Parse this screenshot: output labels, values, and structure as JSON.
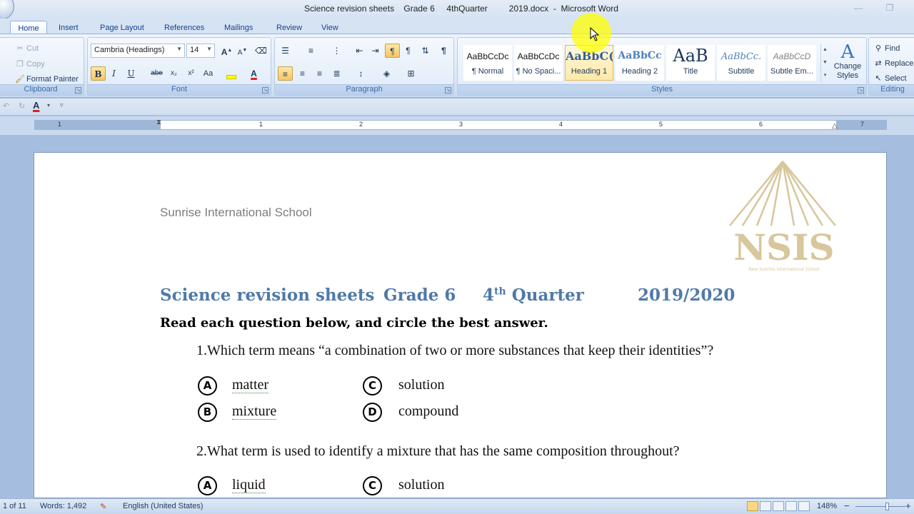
{
  "window": {
    "title": "Science revision sheets    Grade 6     4thQuarter         2019.docx  -  Microsoft Word",
    "minimize": "—",
    "restore": "❐"
  },
  "tabs": [
    {
      "label": "Home",
      "active": true
    },
    {
      "label": "Insert"
    },
    {
      "label": "Page Layout"
    },
    {
      "label": "References"
    },
    {
      "label": "Mailings"
    },
    {
      "label": "Review"
    },
    {
      "label": "View"
    }
  ],
  "clipboard": {
    "cut": "Cut",
    "copy": "Copy",
    "format_painter": "Format Painter",
    "label": "Clipboard"
  },
  "font": {
    "family": "Cambria (Headings)",
    "size": "14",
    "label": "Font",
    "grow": "A",
    "shrink": "A",
    "bold": "B",
    "italic": "I",
    "underline": "U",
    "strike": "abe",
    "subscript": "x₂",
    "superscript": "x²",
    "change_case": "Aa",
    "highlight_color": "#ffff00",
    "font_color": "#e02020"
  },
  "paragraph": {
    "label": "Paragraph",
    "pilcrow": "¶"
  },
  "styles": {
    "label": "Styles",
    "items": [
      {
        "sample": "AaBbCcDc",
        "name": "¶ Normal"
      },
      {
        "sample": "AaBbCcDc",
        "name": "¶ No Spaci..."
      },
      {
        "sample": "AaBbC(",
        "name": "Heading 1",
        "selected": true
      },
      {
        "sample": "AaBbCc",
        "name": "Heading 2"
      },
      {
        "sample": "AaB",
        "name": "Title"
      },
      {
        "sample": "AaBbCc.",
        "name": "Subtitle"
      },
      {
        "sample": "AaBbCcD",
        "name": "Subtle Em..."
      }
    ],
    "change_styles": "Change Styles"
  },
  "editing": {
    "find": "Find",
    "replace": "Replace",
    "select": "Select",
    "label": "Editing"
  },
  "ruler": {
    "numbers": [
      "1",
      "1",
      "2",
      "3",
      "4",
      "5",
      "6",
      "7"
    ]
  },
  "document": {
    "school": "Sunrise International School",
    "logo_text": "NSIS",
    "logo_caption": "New Sunrise International School",
    "heading": {
      "part1": "Science revision sheets",
      "part2": "Grade 6",
      "quarter_num": "4",
      "quarter_sup": "th",
      "quarter_word": "Quarter",
      "year": "2019/2020"
    },
    "instruction": "Read each question below, and circle the best answer.",
    "questions": [
      {
        "text": "1.Which term means “a combination of two or more substances that keep their identities”?",
        "options": [
          {
            "letter": "A",
            "text": "matter"
          },
          {
            "letter": "B",
            "text": "mixture"
          },
          {
            "letter": "C",
            "text": "solution"
          },
          {
            "letter": "D",
            "text": "compound"
          }
        ]
      },
      {
        "text": "2.What term is used to identify a mixture that has the same composition throughout?",
        "options": [
          {
            "letter": "A",
            "text": "liquid"
          },
          {
            "letter": "C",
            "text": "solution"
          }
        ]
      }
    ]
  },
  "status": {
    "page": "1 of 11",
    "words": "Words: 1,492",
    "language": "English (United States)",
    "zoom": "148%",
    "zoom_minus": "−",
    "zoom_plus": "+"
  },
  "colors": {
    "heading": "#4f7aa9",
    "logo": "#d8c69c",
    "ribbon_text": "#15428b"
  }
}
